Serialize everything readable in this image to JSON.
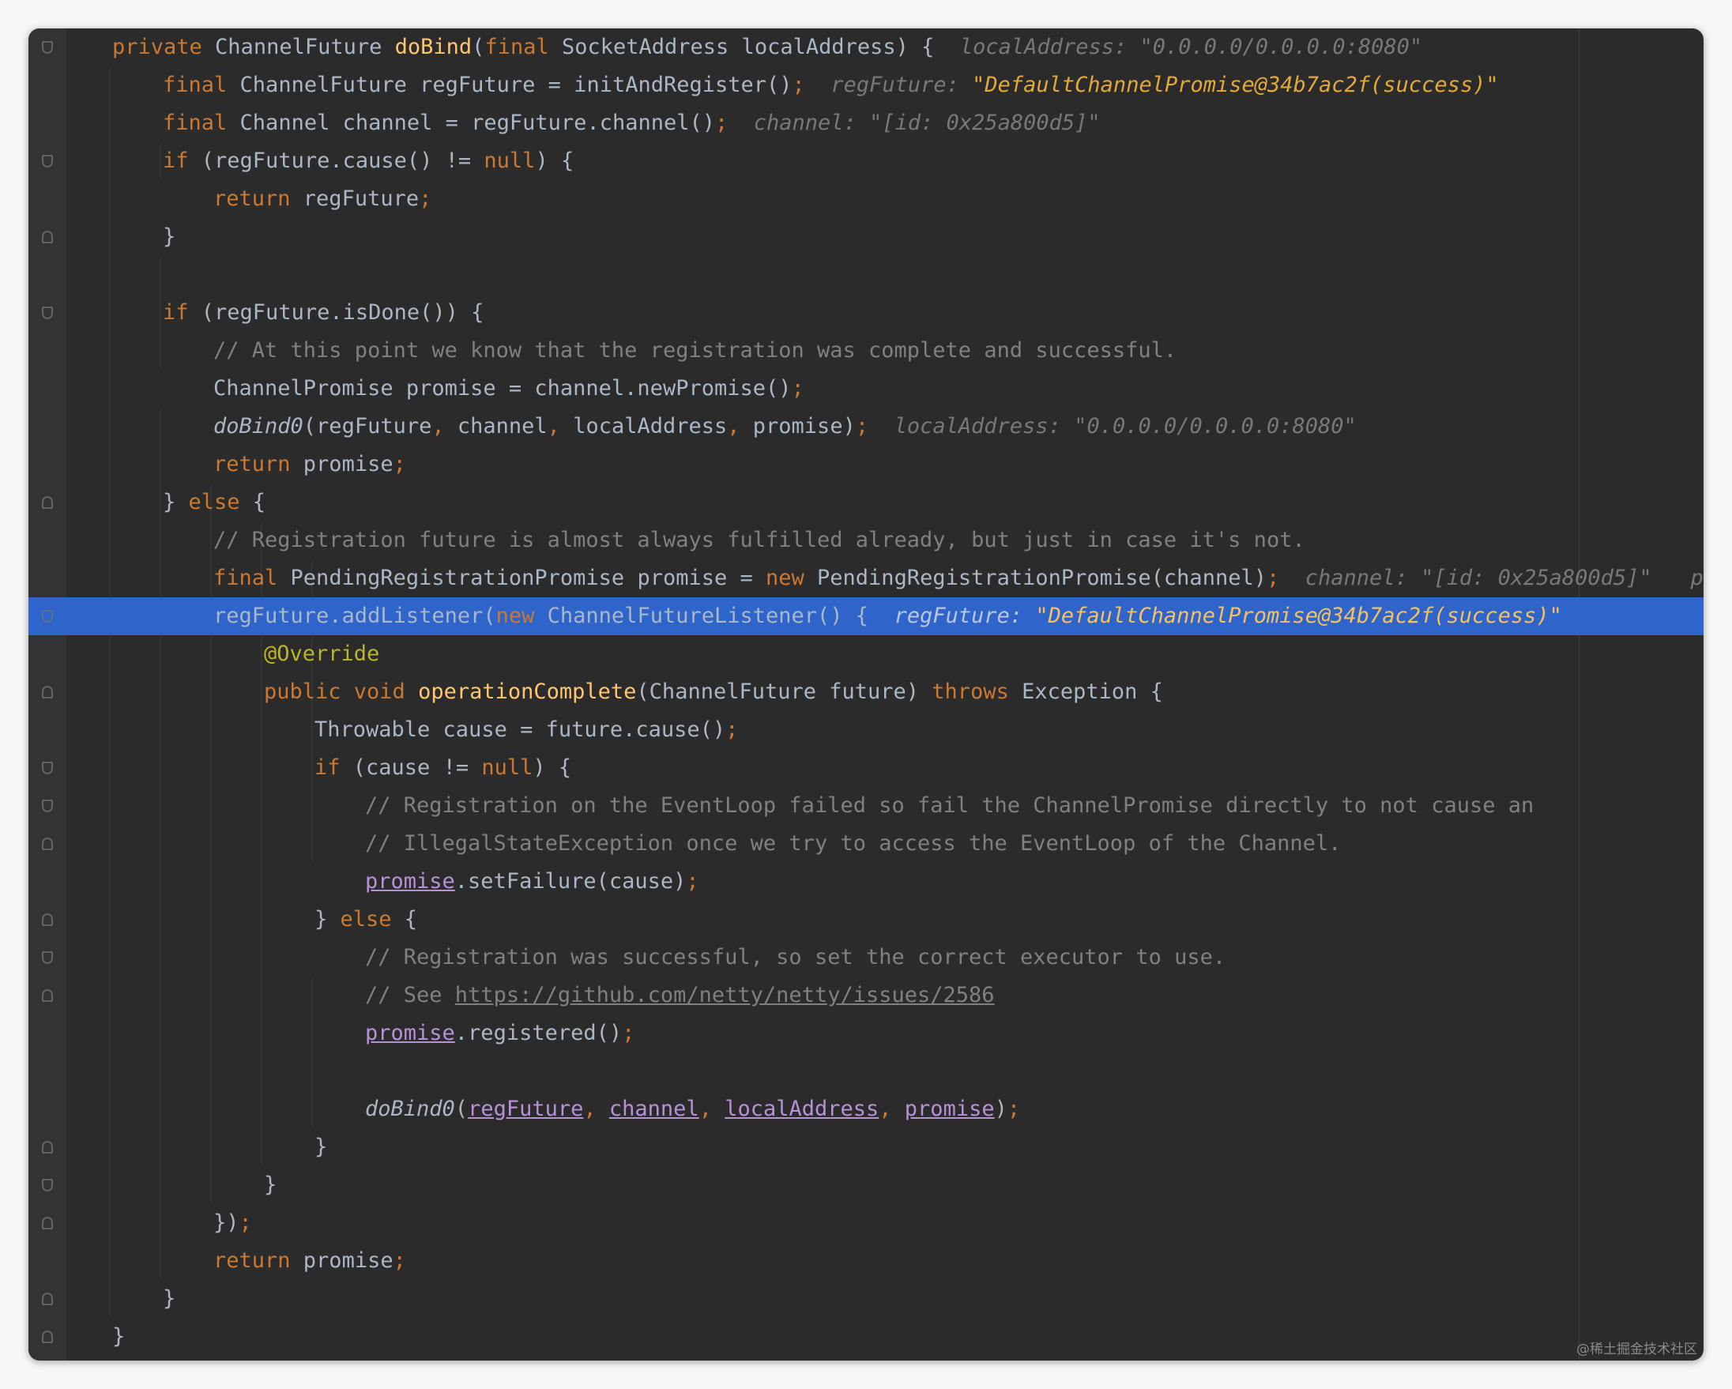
{
  "code": {
    "L1": {
      "kw1": "private ",
      "type": "ChannelFuture ",
      "fn": "doBind",
      "p1": "(",
      "kw2": "final ",
      "rest": "SocketAddress localAddress) {",
      "hint_name": "localAddress: ",
      "hint_val": "\"0.0.0.0/0.0.0.0:8080\""
    },
    "L2": {
      "kw1": "final ",
      "rest": "ChannelFuture regFuture = initAndRegister()",
      "semi": ";",
      "hint_name": "regFuture: ",
      "hint_val": "\"DefaultChannelPromise@34b7ac2f(success)\""
    },
    "L3": {
      "kw1": "final ",
      "rest": "Channel channel = regFuture.channel()",
      "semi": ";",
      "hint_name": "channel: ",
      "hint_val": "\"[id: 0x25a800d5]\""
    },
    "L4": {
      "kw1": "if ",
      "p1": "(regFuture.cause() != ",
      "kw2": "null",
      "p2": ") {"
    },
    "L5": {
      "kw1": "return ",
      "rest": "regFuture",
      "semi": ";"
    },
    "L6": {
      "text": "}"
    },
    "L8": {
      "kw1": "if ",
      "rest": "(regFuture.isDone()) {"
    },
    "L9": {
      "comment": "// At this point we know that the registration was complete and successful."
    },
    "L10": {
      "rest": "ChannelPromise promise = channel.newPromise()",
      "semi": ";"
    },
    "L11": {
      "fn": "doBind0",
      "a": "(regFuture",
      "c1": ", ",
      "b": "channel",
      "c2": ", ",
      "c": "localAddress",
      "c3": ", ",
      "d": "promise)",
      "semi": ";",
      "hint_name": "localAddress: ",
      "hint_val": "\"0.0.0.0/0.0.0.0:8080\""
    },
    "L12": {
      "kw1": "return ",
      "rest": "promise",
      "semi": ";"
    },
    "L13": {
      "p1": "} ",
      "kw1": "else ",
      "p2": "{"
    },
    "L14": {
      "comment": "// Registration future is almost always fulfilled already, but just in case it's not."
    },
    "L15": {
      "kw1": "final ",
      "a": "PendingRegistrationPromise promise = ",
      "kw2": "new ",
      "b": "PendingRegistrationPromise(channel)",
      "semi": ";",
      "hint_name": "channel: ",
      "hint_val": "\"[id: 0x25a800d5]\"",
      "hint_tail": "pr"
    },
    "L16": {
      "a": "regFuture.addListener(",
      "kw1": "new ",
      "b": "ChannelFutureListener() {",
      "hint_name": "regFuture: ",
      "hint_val": "\"DefaultChannelPromise@34b7ac2f(success)\""
    },
    "L17": {
      "ann": "@Override"
    },
    "L18": {
      "kw1": "public void ",
      "fn": "operationComplete",
      "a": "(ChannelFuture future) ",
      "kw2": "throws ",
      "b": "Exception {"
    },
    "L19": {
      "rest": "Throwable cause = future.cause()",
      "semi": ";"
    },
    "L20": {
      "kw1": "if ",
      "p1": "(cause != ",
      "kw2": "null",
      "p2": ") {"
    },
    "L21": {
      "comment": "// Registration on the EventLoop failed so fail the ChannelPromise directly to not cause an"
    },
    "L22": {
      "comment": "// IllegalStateException once we try to access the EventLoop of the Channel."
    },
    "L23": {
      "ul": "promise",
      "rest": ".setFailure(cause)",
      "semi": ";"
    },
    "L24": {
      "p1": "} ",
      "kw1": "else ",
      "p2": "{"
    },
    "L25": {
      "comment": "// Registration was successful, so set the correct executor to use."
    },
    "L26": {
      "comment": "// See ",
      "link": "https://github.com/netty/netty/issues/2586"
    },
    "L27": {
      "ul": "promise",
      "rest": ".registered()",
      "semi": ";"
    },
    "L29": {
      "fn": "doBind0",
      "p1": "(",
      "u1": "regFuture",
      "c1": ", ",
      "u2": "channel",
      "c2": ", ",
      "u3": "localAddress",
      "c3": ", ",
      "u4": "promise",
      "p2": ")",
      "semi": ";"
    },
    "L30": {
      "text": "}"
    },
    "L31": {
      "text": "}"
    },
    "L32": {
      "text": "})",
      "semi": ";"
    },
    "L33": {
      "kw1": "return ",
      "rest": "promise",
      "semi": ";"
    },
    "L34": {
      "text": "}"
    },
    "L35": {
      "text": "}"
    }
  },
  "watermark": "@稀土掘金技术社区",
  "colors": {
    "background": "#2b2b2b",
    "keyword": "#cc7832",
    "method": "#ffc66d",
    "comment": "#808080",
    "annotation": "#bbb529",
    "highlight": "#2f65ca",
    "underlined_ref": "#b990d8"
  }
}
